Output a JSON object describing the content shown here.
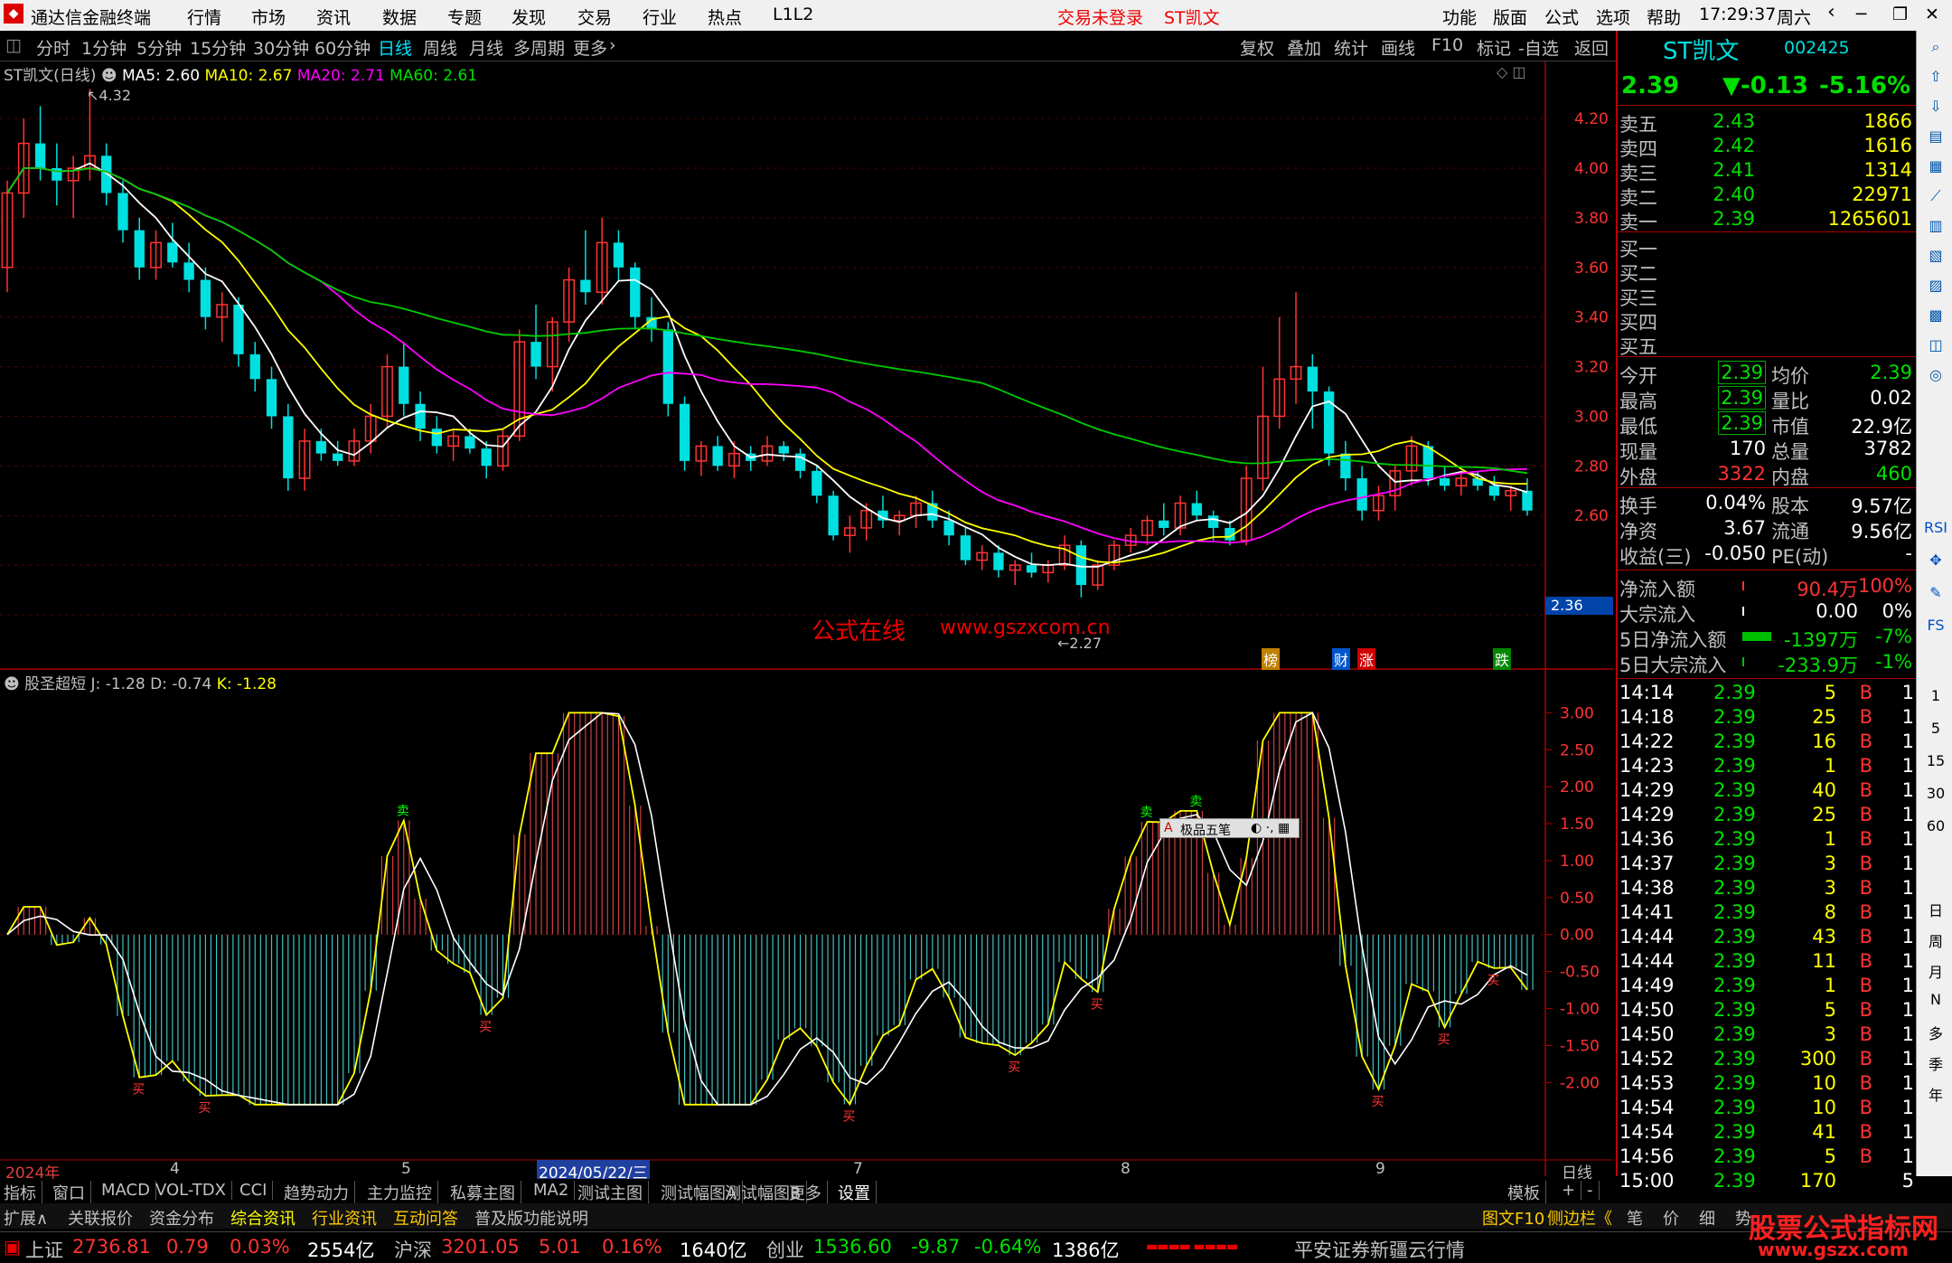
{
  "titlebar": {
    "app": "通达信金融终端",
    "menus": [
      "行情",
      "市场",
      "资讯",
      "数据",
      "专题",
      "发现",
      "交易",
      "行业",
      "热点",
      "L1L2"
    ],
    "login": "交易未登录",
    "stock": "ST凯文",
    "right": [
      "功能",
      "版面",
      "公式",
      "选项",
      "帮助"
    ],
    "time": "17:29:37",
    "weekday": "周六"
  },
  "toolbar": {
    "periods": [
      "分时",
      "1分钟",
      "5分钟",
      "15分钟",
      "30分钟",
      "60分钟",
      "日线",
      "周线",
      "月线",
      "多周期",
      "更多"
    ],
    "active": "日线",
    "tools": [
      "复权",
      "叠加",
      "统计",
      "画线",
      "F10",
      "标记",
      "-自选",
      "返回"
    ]
  },
  "main": {
    "header": "ST凯文(日线)",
    "ma5": "MA5: 2.60",
    "ma10": "MA10: 2.67",
    "ma20": "MA20: 2.71",
    "ma60": "MA60: 2.61",
    "high_mark": "4.32",
    "low_mark": "2.27",
    "price_tag": "2.36",
    "watermark": "公式在线",
    "watermark_url": "www.gszxcom.cn",
    "yticks": [
      "4.20",
      "4.00",
      "3.80",
      "3.60",
      "3.40",
      "3.20",
      "3.00",
      "2.80",
      "2.60"
    ],
    "events": [
      "榜",
      "财",
      "涨",
      "跌"
    ]
  },
  "sub": {
    "header": "股圣超短",
    "j": "J: -1.28",
    "d": "D: -0.74",
    "k": "K: -1.28",
    "yticks": [
      "3.00",
      "2.50",
      "2.00",
      "1.50",
      "1.00",
      "0.50",
      "0.00",
      "-0.50",
      "-1.00",
      "-1.50",
      "-2.00"
    ],
    "buy": "买",
    "sell": "卖",
    "popup": "极品五笔"
  },
  "xaxis": {
    "labels": [
      "2024年",
      "4",
      "5",
      "2024/05/22/三",
      "7",
      "8",
      "9"
    ],
    "period": "日线"
  },
  "quote": {
    "name": "ST凯文",
    "code": "002425",
    "price": "2.39",
    "change": "▼-0.13",
    "pct": "-5.16%",
    "asks": [
      [
        "卖五",
        "2.43",
        "1866"
      ],
      [
        "卖四",
        "2.42",
        "1616"
      ],
      [
        "卖三",
        "2.41",
        "1314"
      ],
      [
        "卖二",
        "2.40",
        "22971"
      ],
      [
        "卖一",
        "2.39",
        "1265601"
      ]
    ],
    "bids": [
      "买一",
      "买二",
      "买三",
      "买四",
      "买五"
    ],
    "stats": [
      [
        "今开",
        "2.39",
        "均价",
        "2.39"
      ],
      [
        "最高",
        "2.39",
        "量比",
        "0.02"
      ],
      [
        "最低",
        "2.39",
        "市值",
        "22.9亿"
      ],
      [
        "现量",
        "170",
        "总量",
        "3782"
      ],
      [
        "外盘",
        "3322",
        "内盘",
        "460"
      ],
      [
        "换手",
        "0.04%",
        "股本",
        "9.57亿"
      ],
      [
        "净资",
        "3.67",
        "流通",
        "9.56亿"
      ],
      [
        "收益(三)",
        "-0.050",
        "PE(动)",
        "-"
      ]
    ],
    "flows": [
      [
        "净流入额",
        "90.4万",
        "100%"
      ],
      [
        "大宗流入",
        "0.00",
        "0%"
      ],
      [
        "5日净流入额",
        "-1397万",
        "-7%"
      ],
      [
        "5日大宗流入",
        "-233.9万",
        "-1%"
      ]
    ],
    "ticks": [
      [
        "14:14",
        "2.39",
        "5",
        "B",
        "1"
      ],
      [
        "14:18",
        "2.39",
        "25",
        "B",
        "1"
      ],
      [
        "14:22",
        "2.39",
        "16",
        "B",
        "1"
      ],
      [
        "14:23",
        "2.39",
        "1",
        "B",
        "1"
      ],
      [
        "14:29",
        "2.39",
        "40",
        "B",
        "1"
      ],
      [
        "14:29",
        "2.39",
        "25",
        "B",
        "1"
      ],
      [
        "14:36",
        "2.39",
        "1",
        "B",
        "1"
      ],
      [
        "14:37",
        "2.39",
        "3",
        "B",
        "1"
      ],
      [
        "14:38",
        "2.39",
        "3",
        "B",
        "1"
      ],
      [
        "14:41",
        "2.39",
        "8",
        "B",
        "1"
      ],
      [
        "14:44",
        "2.39",
        "43",
        "B",
        "1"
      ],
      [
        "14:44",
        "2.39",
        "11",
        "B",
        "1"
      ],
      [
        "14:49",
        "2.39",
        "1",
        "B",
        "1"
      ],
      [
        "14:50",
        "2.39",
        "5",
        "B",
        "1"
      ],
      [
        "14:50",
        "2.39",
        "3",
        "B",
        "1"
      ],
      [
        "14:52",
        "2.39",
        "300",
        "B",
        "1"
      ],
      [
        "14:53",
        "2.39",
        "10",
        "B",
        "1"
      ],
      [
        "14:54",
        "2.39",
        "10",
        "B",
        "1"
      ],
      [
        "14:54",
        "2.39",
        "41",
        "B",
        "1"
      ],
      [
        "14:56",
        "2.39",
        "5",
        "B",
        "1"
      ],
      [
        "15:00",
        "2.39",
        "170",
        "",
        "5"
      ]
    ]
  },
  "sidetools": [
    "日",
    "周",
    "月",
    "N",
    "多",
    "季",
    "年",
    "1",
    "5",
    "15",
    "30",
    "60"
  ],
  "tabs": [
    "指标",
    "窗口",
    "MACD",
    "VOL-TDX",
    "CCI",
    "趋势动力",
    "主力监控",
    "私募主图",
    "MA2",
    "测试主图",
    "测试幅图A",
    "测试幅图B",
    "更多",
    "设置"
  ],
  "tabs_right": [
    "模板",
    "+",
    "-"
  ],
  "tabs2": [
    "扩展∧",
    "关联报价",
    "资金分布",
    "综合资讯",
    "行业资讯",
    "互动问答",
    "普及版功能说明"
  ],
  "tabs2_right": [
    "图文F10",
    "侧边栏《",
    "笔",
    "价",
    "细",
    "势"
  ],
  "status": {
    "sh": "上证",
    "sh_v": "2736.81",
    "sh_c": "0.79",
    "sh_p": "0.03%",
    "sh_a": "2554亿",
    "sz": "沪深",
    "sz_v": "3201.05",
    "sz_c": "5.01",
    "sz_p": "0.16%",
    "sz_a": "1640亿",
    "cy": "创业",
    "cy_v": "1536.60",
    "cy_c": "-9.87",
    "cy_p": "-0.64%",
    "cy_a": "1386亿",
    "broker": "平安证券新疆云行情"
  },
  "brand": {
    "name": "股票公式指标网",
    "url": "www.gszx.com"
  },
  "colors": {
    "up": "#ff3333",
    "down": "#00e0e0",
    "ma5": "#ffffff",
    "ma10": "#ffff00",
    "ma20": "#ff00ff",
    "ma60": "#00cc00"
  },
  "chart_data": {
    "type": "candlestick",
    "title": "ST凯文(日线)",
    "ylim": [
      2.2,
      4.35
    ],
    "ohlc": [
      [
        3.6,
        3.95,
        3.5,
        3.9
      ],
      [
        3.9,
        4.2,
        3.8,
        4.1
      ],
      [
        4.1,
        4.25,
        3.95,
        4.0
      ],
      [
        4.0,
        4.1,
        3.85,
        3.95
      ],
      [
        3.95,
        4.05,
        3.8,
        4.0
      ],
      [
        4.0,
        4.32,
        3.95,
        4.05
      ],
      [
        4.05,
        4.1,
        3.85,
        3.9
      ],
      [
        3.9,
        3.95,
        3.7,
        3.75
      ],
      [
        3.75,
        3.8,
        3.55,
        3.6
      ],
      [
        3.6,
        3.75,
        3.55,
        3.7
      ],
      [
        3.7,
        3.78,
        3.6,
        3.62
      ],
      [
        3.62,
        3.7,
        3.5,
        3.55
      ],
      [
        3.55,
        3.6,
        3.35,
        3.4
      ],
      [
        3.4,
        3.5,
        3.3,
        3.45
      ],
      [
        3.45,
        3.48,
        3.2,
        3.25
      ],
      [
        3.25,
        3.3,
        3.1,
        3.15
      ],
      [
        3.15,
        3.2,
        2.95,
        3.0
      ],
      [
        3.0,
        3.05,
        2.7,
        2.75
      ],
      [
        2.75,
        2.95,
        2.7,
        2.9
      ],
      [
        2.9,
        2.95,
        2.82,
        2.85
      ],
      [
        2.85,
        2.9,
        2.8,
        2.82
      ],
      [
        2.82,
        2.95,
        2.8,
        2.9
      ],
      [
        2.9,
        3.05,
        2.85,
        3.0
      ],
      [
        3.0,
        3.25,
        2.95,
        3.2
      ],
      [
        3.2,
        3.3,
        3.0,
        3.05
      ],
      [
        3.05,
        3.1,
        2.9,
        2.95
      ],
      [
        2.95,
        3.0,
        2.85,
        2.88
      ],
      [
        2.88,
        2.95,
        2.82,
        2.92
      ],
      [
        2.92,
        2.95,
        2.85,
        2.87
      ],
      [
        2.87,
        2.9,
        2.75,
        2.8
      ],
      [
        2.8,
        2.95,
        2.78,
        2.92
      ],
      [
        2.92,
        3.35,
        2.9,
        3.3
      ],
      [
        3.3,
        3.45,
        3.15,
        3.2
      ],
      [
        3.2,
        3.4,
        3.1,
        3.38
      ],
      [
        3.38,
        3.6,
        3.3,
        3.55
      ],
      [
        3.55,
        3.75,
        3.45,
        3.5
      ],
      [
        3.5,
        3.8,
        3.45,
        3.7
      ],
      [
        3.7,
        3.75,
        3.55,
        3.6
      ],
      [
        3.6,
        3.62,
        3.35,
        3.4
      ],
      [
        3.4,
        3.48,
        3.3,
        3.35
      ],
      [
        3.35,
        3.38,
        3.0,
        3.05
      ],
      [
        3.05,
        3.08,
        2.78,
        2.82
      ],
      [
        2.82,
        2.9,
        2.76,
        2.88
      ],
      [
        2.88,
        2.92,
        2.78,
        2.8
      ],
      [
        2.8,
        2.9,
        2.75,
        2.85
      ],
      [
        2.85,
        2.88,
        2.78,
        2.82
      ],
      [
        2.82,
        2.92,
        2.8,
        2.88
      ],
      [
        2.88,
        2.9,
        2.82,
        2.85
      ],
      [
        2.85,
        2.87,
        2.75,
        2.78
      ],
      [
        2.78,
        2.8,
        2.65,
        2.68
      ],
      [
        2.68,
        2.7,
        2.5,
        2.52
      ],
      [
        2.52,
        2.6,
        2.45,
        2.55
      ],
      [
        2.55,
        2.65,
        2.5,
        2.62
      ],
      [
        2.62,
        2.68,
        2.55,
        2.58
      ],
      [
        2.58,
        2.62,
        2.52,
        2.6
      ],
      [
        2.6,
        2.68,
        2.55,
        2.65
      ],
      [
        2.65,
        2.7,
        2.55,
        2.58
      ],
      [
        2.58,
        2.62,
        2.48,
        2.52
      ],
      [
        2.52,
        2.55,
        2.4,
        2.42
      ],
      [
        2.42,
        2.48,
        2.38,
        2.45
      ],
      [
        2.45,
        2.48,
        2.35,
        2.38
      ],
      [
        2.38,
        2.42,
        2.32,
        2.4
      ],
      [
        2.4,
        2.45,
        2.35,
        2.37
      ],
      [
        2.37,
        2.42,
        2.33,
        2.4
      ],
      [
        2.4,
        2.52,
        2.38,
        2.48
      ],
      [
        2.48,
        2.5,
        2.27,
        2.32
      ],
      [
        2.32,
        2.42,
        2.3,
        2.4
      ],
      [
        2.4,
        2.5,
        2.38,
        2.48
      ],
      [
        2.48,
        2.55,
        2.45,
        2.52
      ],
      [
        2.52,
        2.6,
        2.48,
        2.58
      ],
      [
        2.58,
        2.65,
        2.52,
        2.55
      ],
      [
        2.55,
        2.68,
        2.52,
        2.65
      ],
      [
        2.65,
        2.7,
        2.58,
        2.6
      ],
      [
        2.6,
        2.62,
        2.5,
        2.55
      ],
      [
        2.55,
        2.58,
        2.48,
        2.5
      ],
      [
        2.5,
        2.8,
        2.48,
        2.75
      ],
      [
        2.75,
        3.2,
        2.7,
        3.0
      ],
      [
        3.0,
        3.4,
        2.95,
        3.15
      ],
      [
        3.15,
        3.5,
        3.05,
        3.2
      ],
      [
        3.2,
        3.25,
        2.95,
        3.1
      ],
      [
        3.1,
        3.12,
        2.8,
        2.85
      ],
      [
        2.85,
        2.9,
        2.7,
        2.75
      ],
      [
        2.75,
        2.8,
        2.58,
        2.62
      ],
      [
        2.62,
        2.72,
        2.58,
        2.68
      ],
      [
        2.68,
        2.8,
        2.62,
        2.78
      ],
      [
        2.78,
        2.92,
        2.72,
        2.88
      ],
      [
        2.88,
        2.9,
        2.72,
        2.75
      ],
      [
        2.75,
        2.8,
        2.7,
        2.72
      ],
      [
        2.72,
        2.78,
        2.68,
        2.75
      ],
      [
        2.75,
        2.78,
        2.7,
        2.72
      ],
      [
        2.72,
        2.76,
        2.66,
        2.68
      ],
      [
        2.68,
        2.72,
        2.62,
        2.7
      ],
      [
        2.7,
        2.75,
        2.6,
        2.62
      ]
    ]
  }
}
